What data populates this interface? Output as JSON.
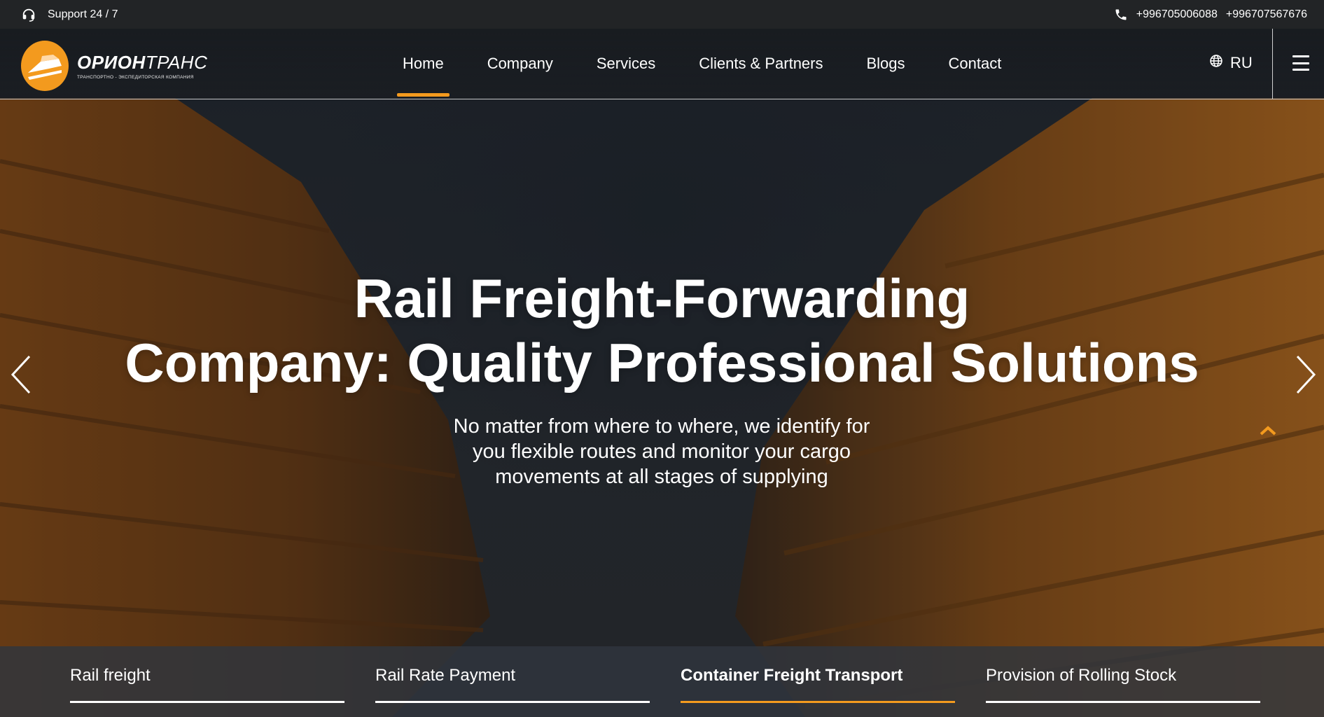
{
  "topbar": {
    "support_label": "Support 24 / 7",
    "support_icon": "headset-icon",
    "phone_icon": "phone-icon",
    "phones": [
      "+996705006088",
      "+996707567676"
    ]
  },
  "header": {
    "logo": {
      "name_bold": "ОРИОН",
      "name_thin": "ТРАНС",
      "tagline": "ТРАНСПОРТНО - ЭКСПЕДИТОРСКАЯ КОМПАНИЯ"
    },
    "nav": [
      {
        "label": "Home",
        "active": true
      },
      {
        "label": "Company",
        "active": false
      },
      {
        "label": "Services",
        "active": false
      },
      {
        "label": "Clients & Partners",
        "active": false
      },
      {
        "label": "Blogs",
        "active": false
      },
      {
        "label": "Contact",
        "active": false
      }
    ],
    "language": "RU",
    "globe_icon": "globe-icon",
    "menu_icon": "hamburger-menu-icon"
  },
  "hero": {
    "title_line1": "Rail Freight-Forwarding",
    "title_line2": "Company: Quality Professional Solutions",
    "subtitle_line1": "No matter from where to where, we identify for",
    "subtitle_line2": "you flexible routes and monitor your cargo",
    "subtitle_line3": "movements at all stages of supplying",
    "prev_icon": "chevron-left-icon",
    "next_icon": "chevron-right-icon",
    "scroll_up_icon": "chevron-up-icon"
  },
  "tabs": [
    {
      "label": "Rail freight",
      "active": false
    },
    {
      "label": "Rail Rate Payment",
      "active": false
    },
    {
      "label": "Container Freight Transport",
      "active": true
    },
    {
      "label": "Provision of Rolling Stock",
      "active": false
    }
  ],
  "colors": {
    "accent": "#f39a1e",
    "topbar_bg": "#222426",
    "tabs_bg": "#30363e"
  }
}
